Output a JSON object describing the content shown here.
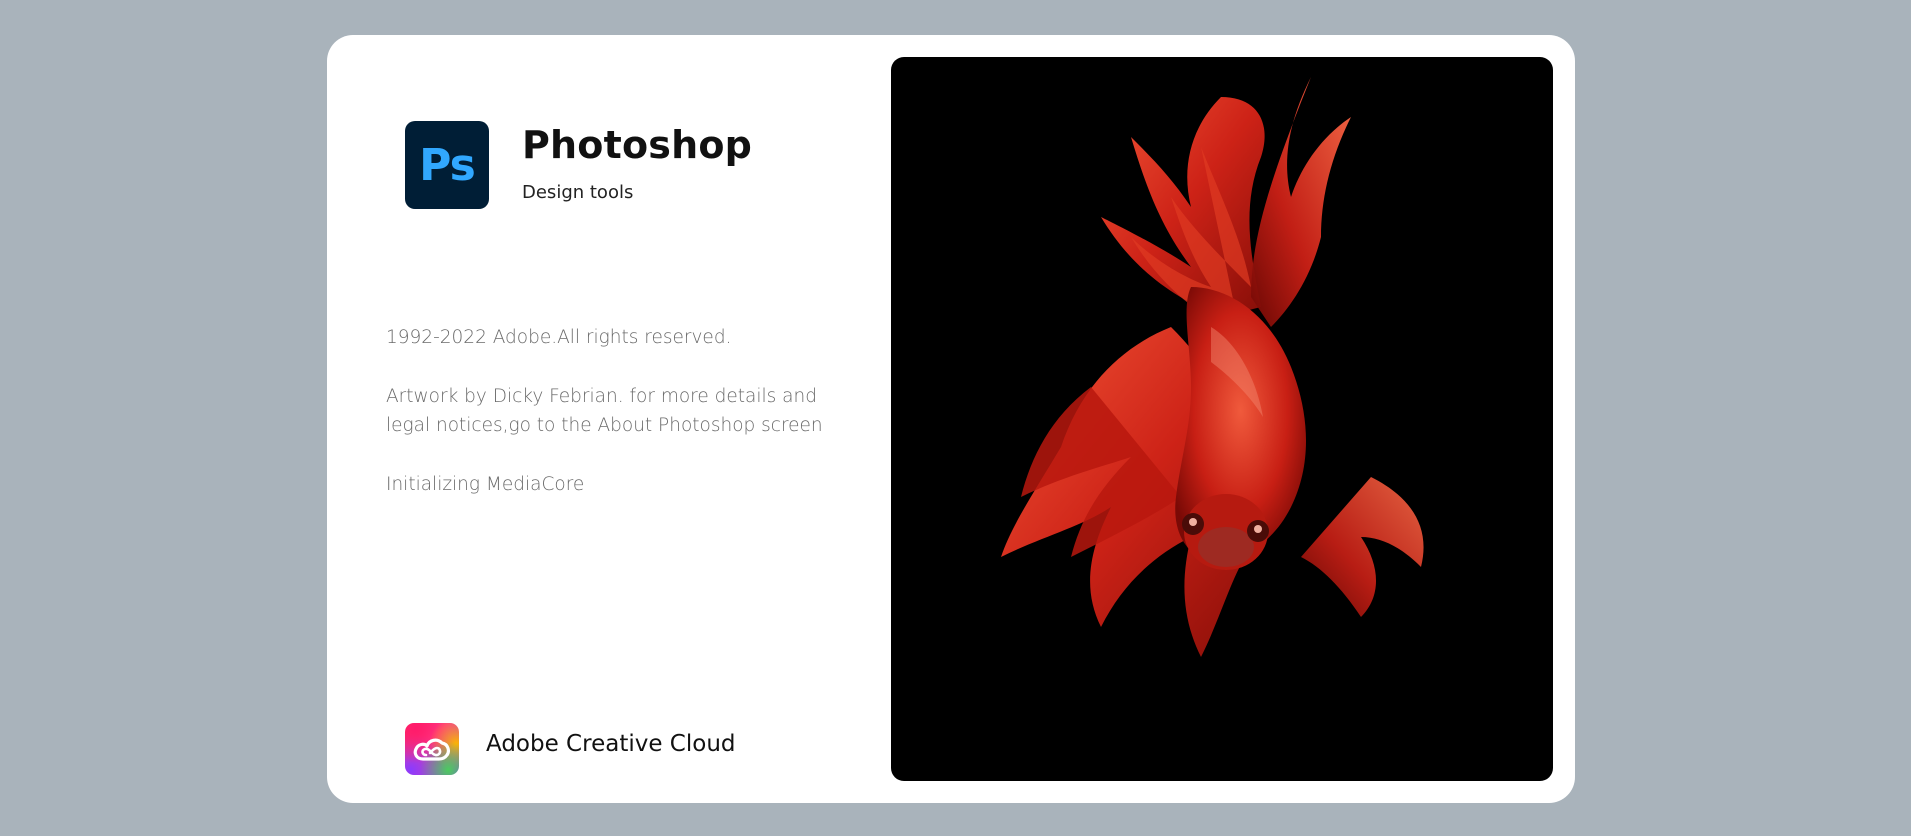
{
  "app": {
    "icon_text": "Ps",
    "title": "Photoshop",
    "subtitle": "Design tools"
  },
  "info": {
    "copyright": "1992-2022 Adobe.All rights reserved.",
    "artwork": "Artwork by Dicky Febrian. for more details and legal notices,go to the About Photoshop screen",
    "status": "Initializing MediaCore"
  },
  "footer": {
    "label": "Adobe Creative Cloud"
  },
  "colors": {
    "background": "#a9b3bb",
    "card": "#ffffff",
    "ps_icon_bg": "#001e36",
    "ps_icon_text": "#31a8ff",
    "artwork_bg": "#000000",
    "fish": "#d42a1c"
  },
  "icons": {
    "app_icon": "photoshop-icon",
    "footer_icon": "creative-cloud-icon"
  }
}
